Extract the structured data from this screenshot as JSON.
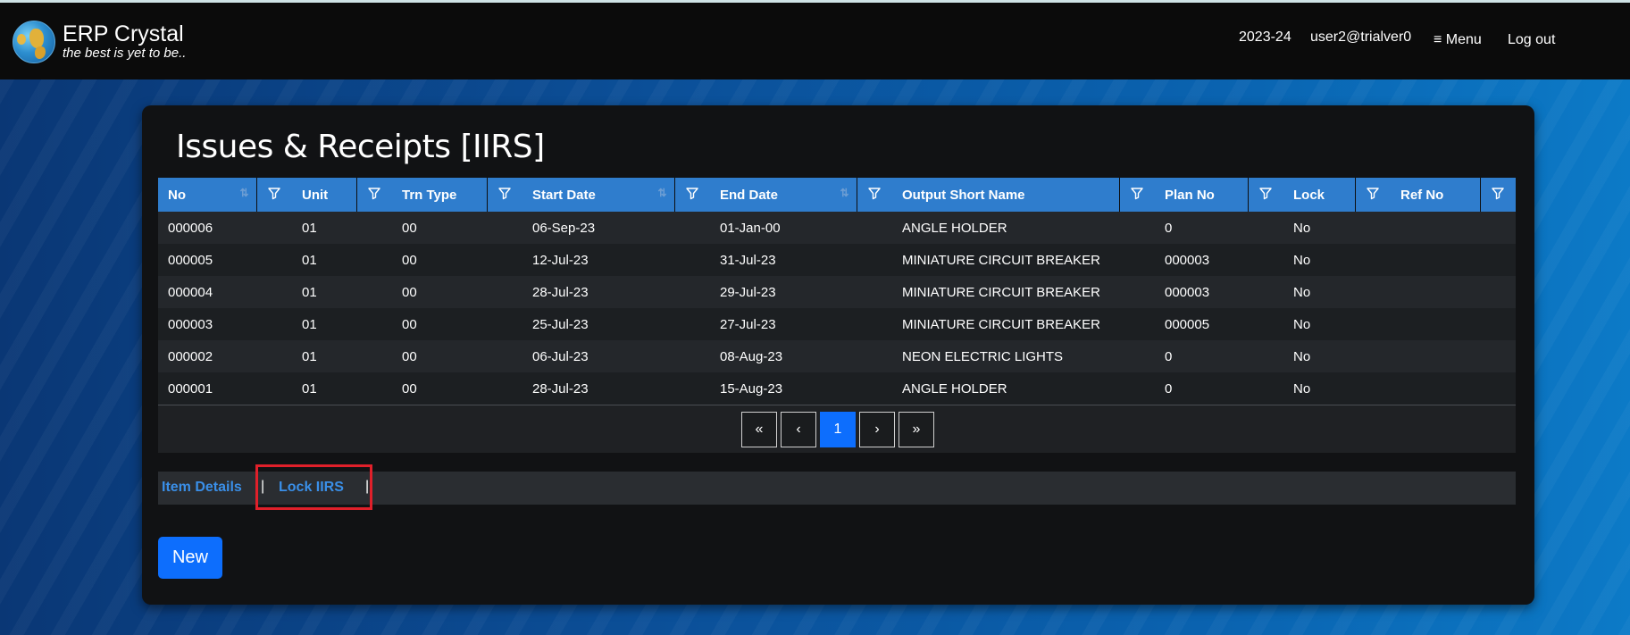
{
  "app": {
    "name": "ERP Crystal",
    "tagline": "the best is yet to be..",
    "logo_icon": "globe-icon"
  },
  "nav": {
    "year": "2023-24",
    "user": "user2@trialver0",
    "menu_icon": "≡",
    "menu_label": "Menu",
    "logout_label": "Log out"
  },
  "page": {
    "title": "Issues & Receipts [IIRS]"
  },
  "table": {
    "columns": [
      "No",
      "Unit",
      "Trn Type",
      "Start Date",
      "End Date",
      "Output Short Name",
      "Plan No",
      "Lock",
      "Ref No"
    ],
    "sortable_columns": [
      "No",
      "Start Date",
      "End Date"
    ],
    "rows": [
      [
        "000006",
        "01",
        "00",
        "06-Sep-23",
        "01-Jan-00",
        "ANGLE HOLDER",
        "0",
        "No",
        ""
      ],
      [
        "000005",
        "01",
        "00",
        "12-Jul-23",
        "31-Jul-23",
        "MINIATURE CIRCUIT BREAKER",
        "000003",
        "No",
        ""
      ],
      [
        "000004",
        "01",
        "00",
        "28-Jul-23",
        "29-Jul-23",
        "MINIATURE CIRCUIT BREAKER",
        "000003",
        "No",
        ""
      ],
      [
        "000003",
        "01",
        "00",
        "25-Jul-23",
        "27-Jul-23",
        "MINIATURE CIRCUIT BREAKER",
        "000005",
        "No",
        ""
      ],
      [
        "000002",
        "01",
        "00",
        "06-Jul-23",
        "08-Aug-23",
        "NEON ELECTRIC LIGHTS",
        "0",
        "No",
        ""
      ],
      [
        "000001",
        "01",
        "00",
        "28-Jul-23",
        "15-Aug-23",
        "ANGLE HOLDER",
        "0",
        "No",
        ""
      ]
    ]
  },
  "pager": {
    "first": "«",
    "prev": "‹",
    "current": "1",
    "next": "›",
    "last": "»"
  },
  "tabs": {
    "item_details": "Item Details",
    "separator": "|",
    "lock_iirs": "Lock IIRS"
  },
  "actions": {
    "new_label": "New"
  },
  "colors": {
    "header_blue": "#2f7dcd",
    "primary": "#0d6efd",
    "link": "#3a8fe8",
    "highlight": "#e0202a"
  }
}
